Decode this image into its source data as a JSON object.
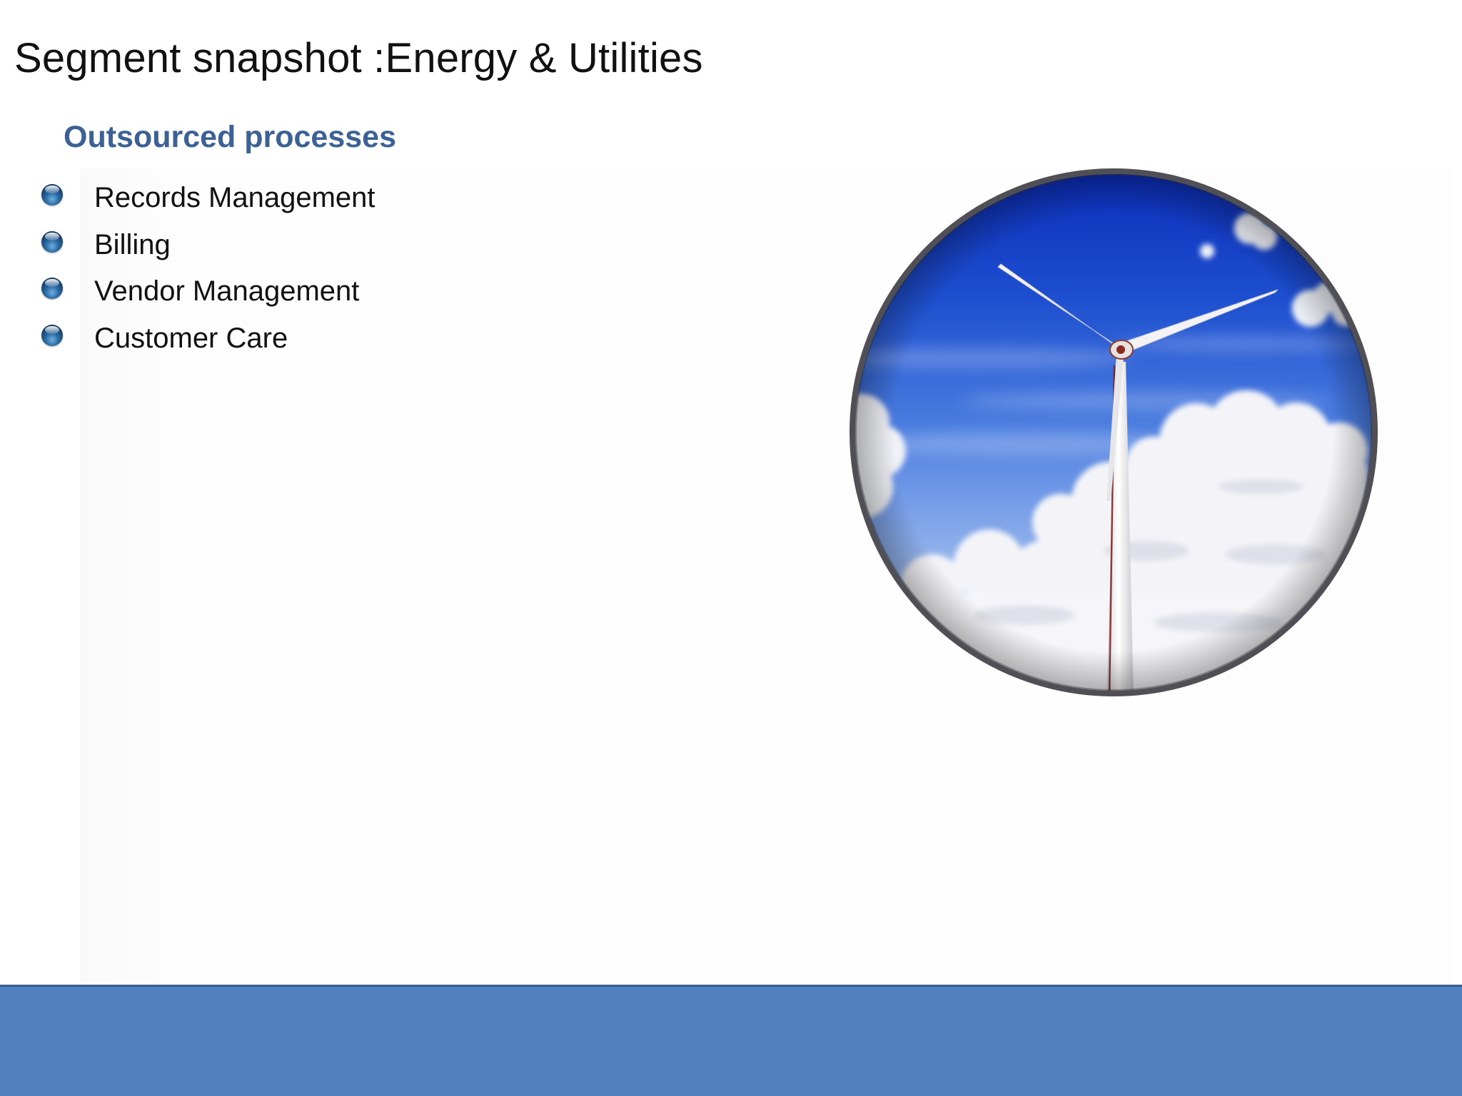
{
  "slide": {
    "title": "Segment snapshot :Energy & Utilities",
    "subtitle": "Outsourced processes",
    "bullets": [
      "Records Management",
      "Billing",
      "Vendor Management",
      "Customer Care"
    ],
    "image": {
      "subject": "wind-turbine-photo"
    }
  },
  "colors": {
    "title_text": "#111111",
    "subtitle_text": "#3c6295",
    "footer_bar": "#5080bf",
    "bullet_globe": "#2a6aa3"
  }
}
